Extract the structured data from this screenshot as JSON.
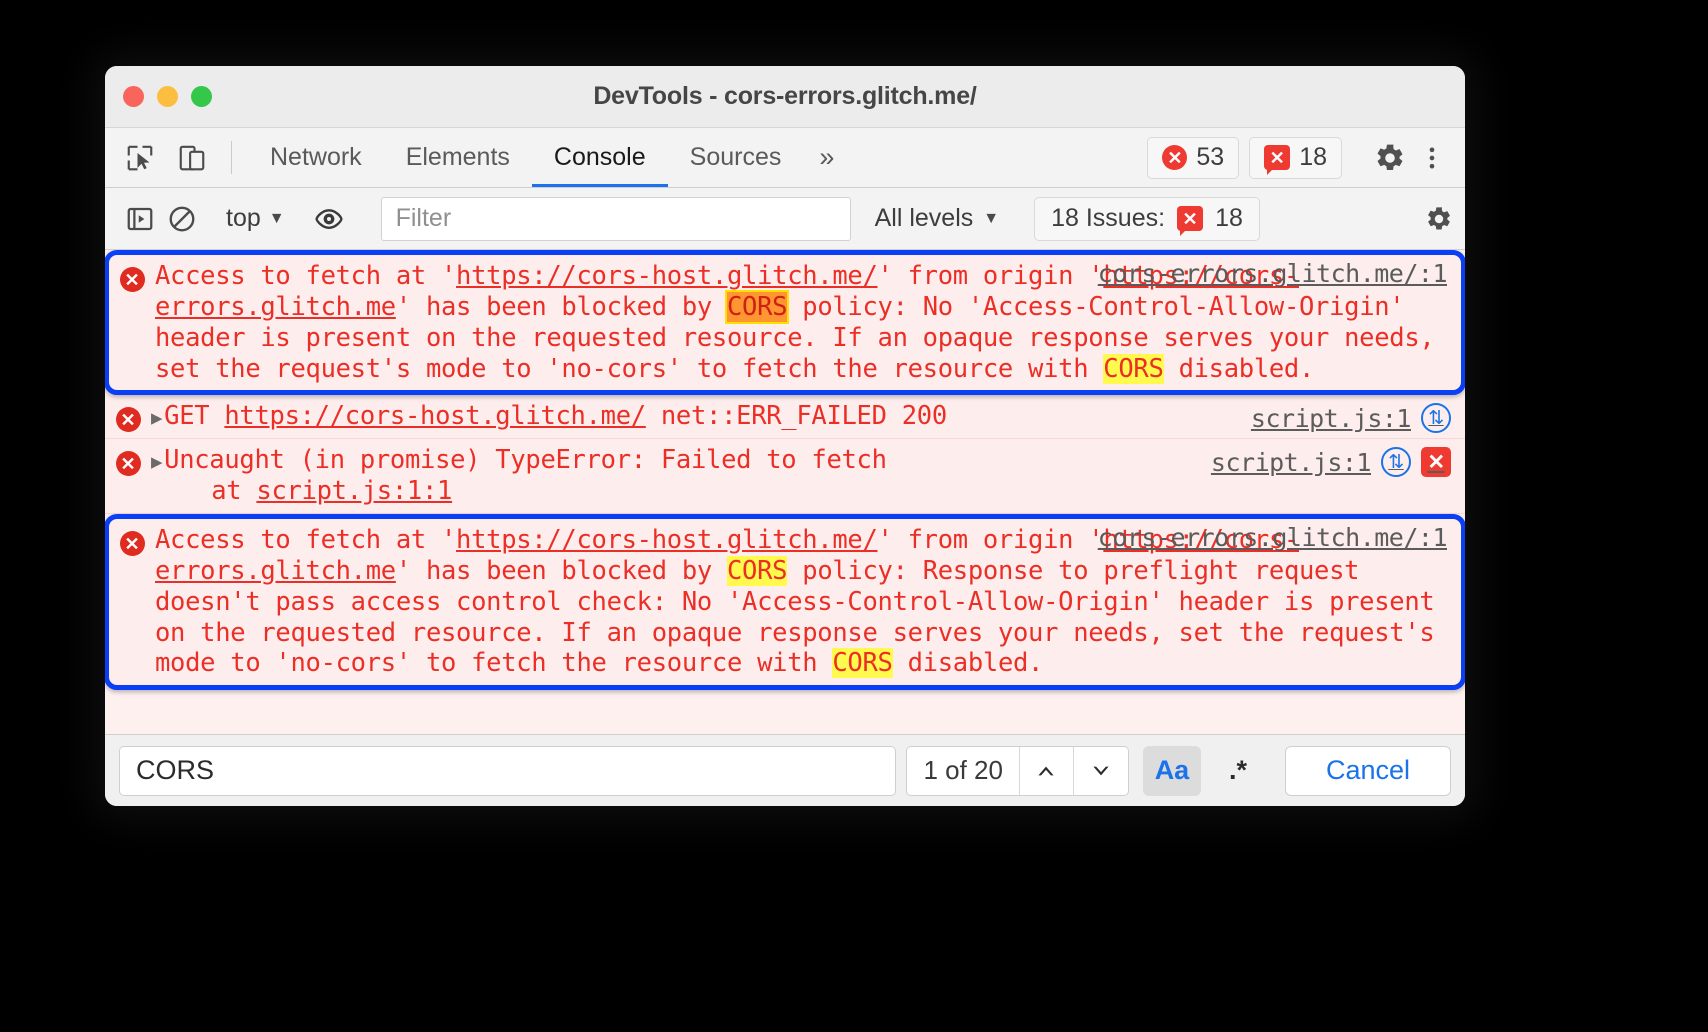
{
  "window": {
    "title": "DevTools - cors-errors.glitch.me/",
    "traffic_lights": [
      "close",
      "minimize",
      "zoom"
    ]
  },
  "tabbar": {
    "inspect_icon": "cursor-select-icon",
    "device_icon": "device-toolbar-icon",
    "tabs": [
      {
        "label": "Network",
        "active": false
      },
      {
        "label": "Elements",
        "active": false
      },
      {
        "label": "Console",
        "active": true
      },
      {
        "label": "Sources",
        "active": false
      }
    ],
    "more_label": "»",
    "error_count": "53",
    "issue_count": "18",
    "settings_icon": "gear-icon",
    "more_menu_icon": "kebab-menu-icon"
  },
  "console_toolbar": {
    "sidebar_icon": "show-console-sidebar-icon",
    "clear_icon": "clear-console-icon",
    "context": "top",
    "context_caret": "▼",
    "eye_icon": "live-expression-icon",
    "filter_placeholder": "Filter",
    "levels_label": "All levels",
    "levels_caret": "▼",
    "issues_label": "18 Issues:",
    "issues_badge": "18",
    "settings_icon": "gear-icon"
  },
  "messages": [
    {
      "id": "cors-1",
      "ringed": true,
      "icon": "error-icon",
      "source": "cors-errors.glitch.me/:1",
      "segments": [
        {
          "t": "Access to fetch at '",
          "s": "plain"
        },
        {
          "t": "https://cors-host.glitch.me/",
          "s": "link"
        },
        {
          "t": "' from origin '",
          "s": "plain"
        },
        {
          "t": "https://cors-errors.glitch.me",
          "s": "link"
        },
        {
          "t": "' has been blocked by ",
          "s": "plain"
        },
        {
          "t": "CORS",
          "s": "hl-active"
        },
        {
          "t": " policy: No 'Access-Control-Allow-Origin' header is present on the requested resource. If an opaque response serves your needs, set the request's mode to 'no-cors' to fetch the resource with ",
          "s": "plain"
        },
        {
          "t": "CORS",
          "s": "hl"
        },
        {
          "t": " disabled.",
          "s": "plain"
        }
      ],
      "right_icons": []
    },
    {
      "id": "get-failed",
      "ringed": false,
      "icon": "error-icon",
      "expander": "▶",
      "source": "script.js:1",
      "segments": [
        {
          "t": "GET ",
          "s": "plain"
        },
        {
          "t": "https://cors-host.glitch.me/",
          "s": "link"
        },
        {
          "t": " net::ERR_FAILED 200",
          "s": "plain"
        }
      ],
      "right_icons": [
        "network-request-icon"
      ]
    },
    {
      "id": "uncaught-typeerror",
      "ringed": false,
      "icon": "error-icon",
      "expander": "▶",
      "source": "script.js:1",
      "segments": [
        {
          "t": "Uncaught (in promise) TypeError: Failed to fetch\n    at ",
          "s": "plain"
        },
        {
          "t": "script.js:1:1",
          "s": "link"
        }
      ],
      "right_icons": [
        "network-request-icon",
        "issue-icon"
      ]
    },
    {
      "id": "cors-2",
      "ringed": true,
      "icon": "error-icon",
      "source": "cors-errors.glitch.me/:1",
      "segments": [
        {
          "t": "Access to fetch at '",
          "s": "plain"
        },
        {
          "t": "https://cors-host.glitch.me/",
          "s": "link"
        },
        {
          "t": "' from origin '",
          "s": "plain"
        },
        {
          "t": "https://cors-errors.glitch.me",
          "s": "link"
        },
        {
          "t": "' has been blocked by ",
          "s": "plain"
        },
        {
          "t": "CORS",
          "s": "hl"
        },
        {
          "t": " policy: Response to preflight request doesn't pass access control check: No 'Access-Control-Allow-Origin' header is present on the requested resource. If an opaque response serves your needs, set the request's mode to 'no-cors' to fetch the resource with ",
          "s": "plain"
        },
        {
          "t": "CORS",
          "s": "hl"
        },
        {
          "t": " disabled.",
          "s": "plain"
        }
      ],
      "right_icons": []
    }
  ],
  "searchbar": {
    "query": "CORS",
    "match_count": "1 of 20",
    "prev_icon": "⌃",
    "next_icon": "⌄",
    "match_case_label": "Aa",
    "match_case_on": true,
    "regex_label": ".*",
    "cancel_label": "Cancel"
  },
  "colors": {
    "accent_blue": "#1a73e8",
    "ring_blue": "#0b3ff5",
    "error_red": "#eb2f26",
    "error_bg": "#fdeeed",
    "highlight_yellow": "#fffa4d",
    "highlight_active_orange": "#ff9632"
  }
}
